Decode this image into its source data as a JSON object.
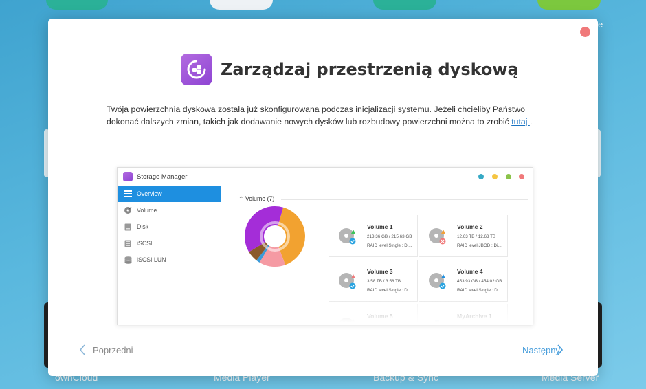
{
  "background": {
    "labels": [
      "ownCloud",
      "Media Player",
      "Backup & Sync",
      "Media Server"
    ],
    "edge_letter": "e"
  },
  "dialog": {
    "title": "Zarządzaj przestrzenią dyskową",
    "description": "Twója powierzchnia dyskowa została już skonfigurowana podczas inicjalizacji systemu. Jeżeli chcieliby Państwo dokonać dalszych zmian, takich jak dodawanie nowych dysków lub rozbudowy powierzchni można to zrobić ",
    "link_text": "tutaj ",
    "period": ".",
    "prev_label": "Poprzedni",
    "next_label": "Następny",
    "icon": "storage-manager-icon",
    "colors": {
      "accent": "#1e8fe0",
      "link": "#1a73c2",
      "close": "#f0797a"
    }
  },
  "storage_manager": {
    "title": "Storage Manager",
    "nav": [
      {
        "label": "Overview",
        "icon": "overview-icon",
        "active": true
      },
      {
        "label": "Volume",
        "icon": "volume-icon",
        "active": false
      },
      {
        "label": "Disk",
        "icon": "disk-icon",
        "active": false
      },
      {
        "label": "iSCSI",
        "icon": "iscsi-icon",
        "active": false
      },
      {
        "label": "iSCSI LUN",
        "icon": "iscsi-lun-icon",
        "active": false
      }
    ],
    "section_title": "Volume (7)",
    "volumes": [
      {
        "name": "Volume 1",
        "size": "213.36 GB / 215.63 GB",
        "raid": "RAID level Single : Di...",
        "status": "ok",
        "fill": "#3ec45a"
      },
      {
        "name": "Volume 2",
        "size": "12.63 TB / 12.63 TB",
        "raid": "RAID level JBOD : Di...",
        "status": "error",
        "fill": "#f2a03a"
      },
      {
        "name": "Volume 3",
        "size": "3.58 TB / 3.58 TB",
        "raid": "RAID level Single : Di...",
        "status": "ok",
        "fill": "#f0797a"
      },
      {
        "name": "Volume 4",
        "size": "453.93 GB / 454.02 GB",
        "raid": "RAID level Single : Di...",
        "status": "ok",
        "fill": "#1e8fe0"
      },
      {
        "name": "Volume 5",
        "size": "",
        "raid": "",
        "status": "ok",
        "fill": "#c0c0c0"
      },
      {
        "name": "MyArchive 1",
        "size": "",
        "raid": "",
        "status": "archive",
        "fill": "#9ab"
      }
    ],
    "donut": [
      {
        "value": 40,
        "color": "#f2a230"
      },
      {
        "value": 14,
        "color": "#f59aa3"
      },
      {
        "value": 2,
        "color": "#3a9ad9"
      },
      {
        "value": 6,
        "color": "#8b5a2b"
      },
      {
        "value": 38,
        "color": "#a42dd8"
      }
    ],
    "window_dots": [
      "#36a9c5",
      "#f5c542",
      "#8bc34a",
      "#f0797a"
    ]
  }
}
